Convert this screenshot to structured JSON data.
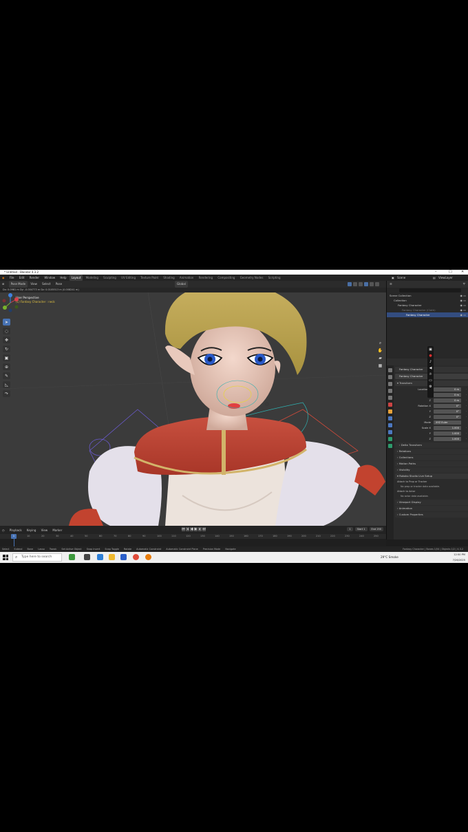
{
  "window": {
    "title": "* Untitled - Blender 4.3.2",
    "controls": [
      "–",
      "□",
      "✕"
    ]
  },
  "menubar": {
    "menus": [
      "File",
      "Edit",
      "Render",
      "Window",
      "Help"
    ],
    "workspaces": [
      "Layout",
      "Modeling",
      "Sculpting",
      "UV Editing",
      "Texture Paint",
      "Shading",
      "Animation",
      "Rendering",
      "Compositing",
      "Geometry Nodes",
      "Scripting"
    ],
    "active_workspace": "Layout",
    "scene": "Scene",
    "view_layer": "ViewLayer"
  },
  "viewport_header": {
    "mode": "Pose Mode",
    "menus": [
      "View",
      "Select",
      "Pose"
    ],
    "orientation": "Global"
  },
  "tool_settings": {
    "text": "Dx: 0.0981 m  Dy: -0.004773 m  Dz: 0.0105513 m (0.008241 m)"
  },
  "viewport": {
    "perspective_label": "User Perspective",
    "object_label": "(1) Fantasy Character : neck"
  },
  "timeline": {
    "menus": [
      "Playback",
      "Keying",
      "View",
      "Marker"
    ],
    "current_frame": "1",
    "start_label": "Start",
    "start": "1",
    "end_label": "End",
    "end": "250",
    "ticks": [
      "1",
      "10",
      "20",
      "30",
      "40",
      "50",
      "60",
      "70",
      "80",
      "90",
      "100",
      "110",
      "120",
      "130",
      "140",
      "150",
      "160",
      "170",
      "180",
      "190",
      "200",
      "210",
      "220",
      "230",
      "240",
      "250"
    ]
  },
  "outliner": {
    "rows": [
      {
        "label": "Scene Collection",
        "indent": 4,
        "selected": false,
        "dim": false
      },
      {
        "label": "Collection",
        "indent": 10,
        "selected": false,
        "dim": false
      },
      {
        "label": "Fantasy Character",
        "indent": 16,
        "selected": false,
        "dim": false
      },
      {
        "label": "Fantasy Character (Cloth)",
        "indent": 22,
        "selected": false,
        "dim": true
      },
      {
        "label": "Fantasy Character",
        "indent": 28,
        "selected": true,
        "dim": false
      }
    ]
  },
  "properties": {
    "object_name": "Fantasy Character",
    "object_field": "Fantasy Character",
    "transform_header": "Transform",
    "location": [
      {
        "label": "Location X",
        "value": "0 m"
      },
      {
        "label": "Y",
        "value": "0 m"
      },
      {
        "label": "Z",
        "value": "0 m"
      }
    ],
    "rotation": [
      {
        "label": "Rotation X",
        "value": "0°"
      },
      {
        "label": "Y",
        "value": "0°"
      },
      {
        "label": "Z",
        "value": "0°"
      }
    ],
    "mode": {
      "label": "Mode",
      "value": "XYZ Euler"
    },
    "scale": [
      {
        "label": "Scale X",
        "value": "1.000"
      },
      {
        "label": "Y",
        "value": "1.000"
      },
      {
        "label": "Z",
        "value": "1.000"
      }
    ],
    "panels_a": [
      "Delta Transform",
      "Relations",
      "Collections",
      "Motion Paths",
      "Visibility"
    ],
    "strokes_panel": "Rokoko Studio Live Setup",
    "attach_prop": "Attach to Prop or Tracker",
    "prop_note": "No prop or tracker data available.",
    "attach_actor": "Attach to Actor",
    "actor_note": "No actor data available.",
    "panels_b": [
      "Viewport Display",
      "Animation",
      "Custom Properties"
    ]
  },
  "statusbar": {
    "items": [
      "Select",
      "Extend",
      "Bone",
      "Lasso",
      "Tweak",
      "Set Active Object",
      "Snap Invert",
      "Snap Toggle",
      "Rotate",
      "Automatic Constraint",
      "Automatic Constraint Plane",
      "Precision Mode",
      "Navigate"
    ],
    "right": "Fantasy Character | Bones 1/54 | Objects 1/2 | 4.3.2"
  },
  "taskbar": {
    "search_placeholder": "Type here to search",
    "weather": "29°C  Smoke",
    "time": "12:50 PM",
    "date": "7/26/2025"
  },
  "colors": {
    "accent": "#4772b3",
    "viewport_bg": "#3b3b3b",
    "selected_row": "#334d80",
    "gizmo_x": "#d9404b",
    "gizmo_y": "#79b32c",
    "gizmo_z": "#3f82e0"
  },
  "icons": {
    "toolbar": [
      "cursor-icon",
      "select-icon",
      "move-icon",
      "rotate-icon",
      "scale-icon",
      "transform-icon",
      "annotate-icon",
      "measure-icon",
      "roll-icon"
    ],
    "nav": [
      "zoom-icon",
      "pan-icon",
      "camera-icon",
      "grid-icon"
    ]
  }
}
